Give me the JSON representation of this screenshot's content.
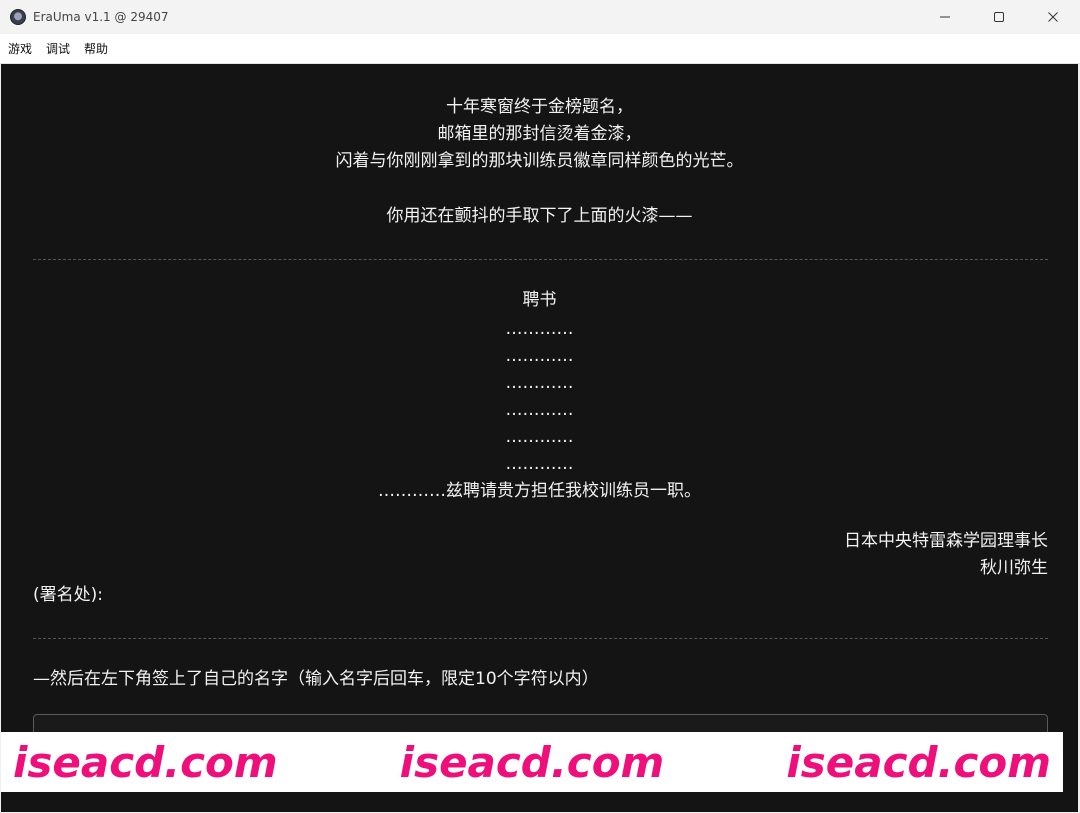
{
  "window": {
    "title": "EraUma v1.1 @ 29407",
    "icon": "app-logo-icon"
  },
  "menu": {
    "items": [
      "游戏",
      "调试",
      "帮助"
    ]
  },
  "story": {
    "lines": [
      "十年寒窗终于金榜题名，",
      "邮箱里的那封信烫着金漆，",
      "闪着与你刚刚拿到的那块训练员徽章同样颜色的光芒。",
      "你用还在颤抖的手取下了上面的火漆——"
    ]
  },
  "letter": {
    "heading": "聘书",
    "dots": [
      "…………",
      "…………",
      "…………",
      "…………",
      "…………",
      "…………"
    ],
    "body": "…………兹聘请贵方担任我校训练员一职。",
    "sign_org": "日本中央特雷森学园理事长",
    "sign_name": "秋川弥生",
    "signature_label": "(署名处):"
  },
  "prompt": {
    "text": "—然后在左下角签上了自己的名字（输入名字后回车，限定10个字符以内）",
    "input_value": "",
    "input_placeholder": ""
  },
  "watermark": {
    "texts": [
      "iseacd.com",
      "iseacd.com",
      "iseacd.com"
    ]
  },
  "colors": {
    "background": "#141414",
    "text": "#f2f2f2",
    "watermark": "#ee0f7a"
  }
}
